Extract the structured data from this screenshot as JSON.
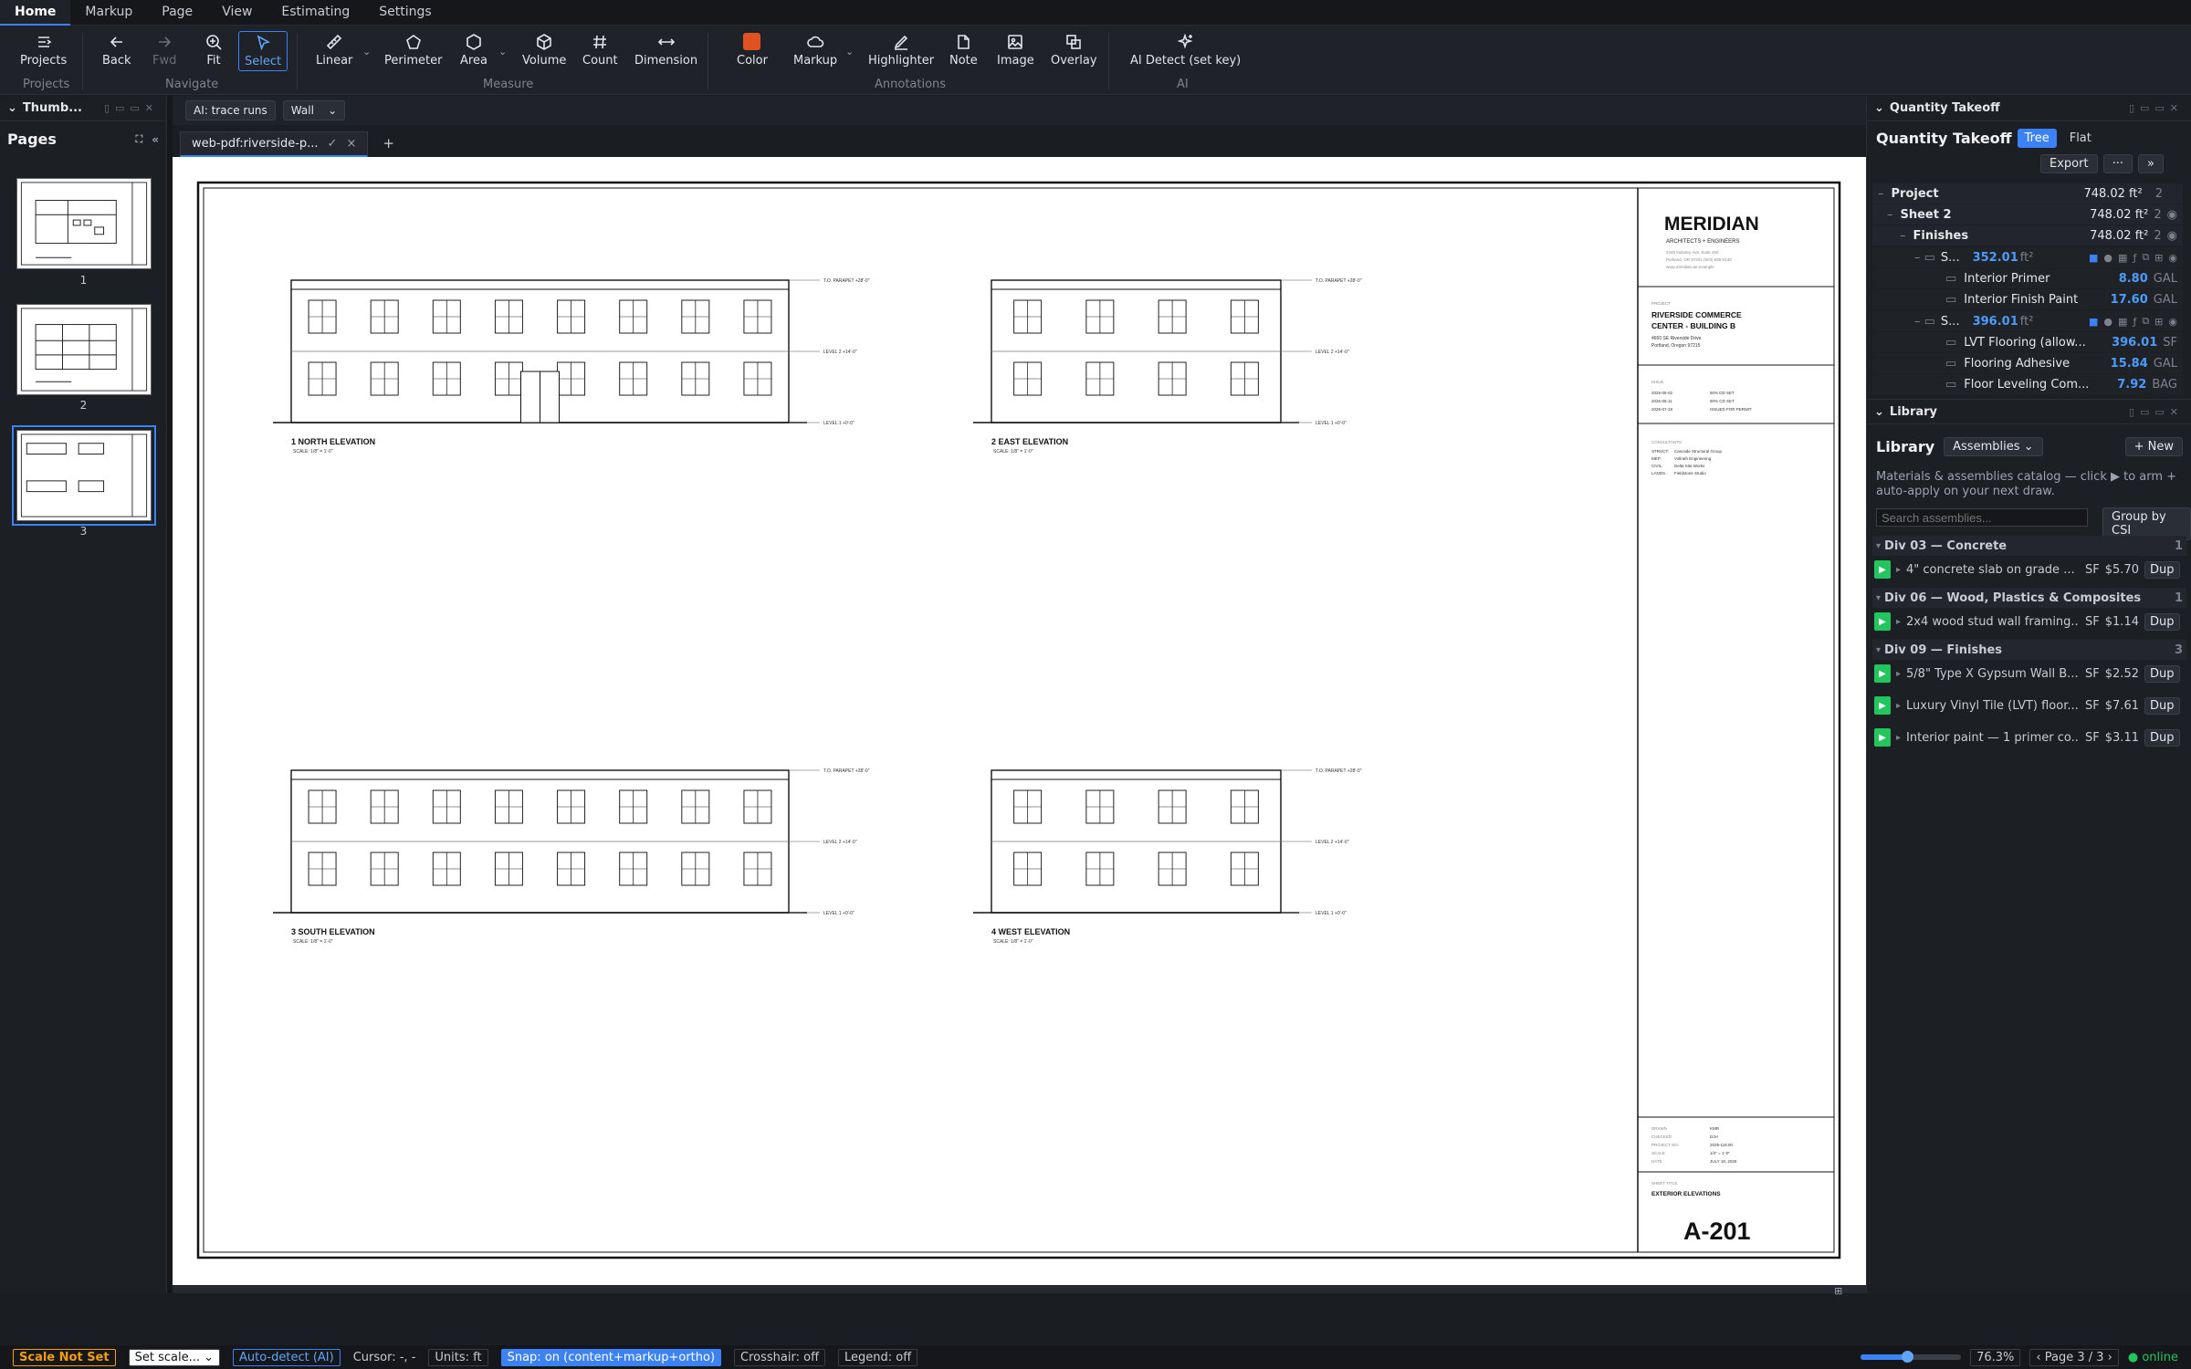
{
  "menu": {
    "tabs": [
      "Home",
      "Markup",
      "Page",
      "View",
      "Estimating",
      "Settings"
    ]
  },
  "ribbon": {
    "projects": "Projects",
    "back": "Back",
    "fwd": "Fwd",
    "fit": "Fit",
    "select": "Select",
    "linear": "Linear",
    "perimeter": "Perimeter",
    "area": "Area",
    "volume": "Volume",
    "count": "Count",
    "dimension": "Dimension",
    "color": "Color",
    "markup": "Markup",
    "highlighter": "Highlighter",
    "note": "Note",
    "image": "Image",
    "overlay": "Overlay",
    "ai_detect": "AI Detect (set key)",
    "groups": {
      "projects": "Projects",
      "navigate": "Navigate",
      "measure": "Measure",
      "annotations": "Annotations",
      "ai": "AI"
    },
    "color_value": "#e0521f"
  },
  "left": {
    "panel_title": "Thumb...",
    "pages_title": "Pages",
    "pages": [
      "1",
      "2",
      "3"
    ]
  },
  "toolrow": {
    "ai_trace": "AI: trace runs",
    "wall": "Wall"
  },
  "doc": {
    "tab": "web-pdf:riverside-p...",
    "tab_check": "✓",
    "tab_close": "×",
    "add": "+"
  },
  "sheet": {
    "firm": "MERIDIAN",
    "firm_sub": "ARCHITECTS + ENGINEERS",
    "firm_addr1": "2345 Industry Ave, Suite 450",
    "firm_addr2": "Portland, OR 97201 (503) 555-0140",
    "firm_addr3": "www.meridian-ae.example",
    "project_label": "PROJECT",
    "project1": "RIVERSIDE COMMERCE",
    "project2": "CENTER - BUILDING B",
    "addr1": "4650 SE Riverside Drive",
    "addr2": "Portland, Oregon 97215",
    "issue_label": "ISSUE",
    "issues": [
      [
        "2026-05-02",
        "90% DD SET"
      ],
      [
        "2026-06-11",
        "90% CD SET"
      ],
      [
        "2026-07-18",
        "ISSUED FOR PERMIT"
      ]
    ],
    "consult_label": "CONSULTANTS",
    "consultants": [
      [
        "STRUCT:",
        "Cascade Structural Group"
      ],
      [
        "MEP:",
        "Vollrath Engineering"
      ],
      [
        "CIVIL:",
        "Delta Site Works"
      ],
      [
        "LANDS.:",
        "Fieldstone Studio"
      ]
    ],
    "meta": [
      [
        "DRAWN",
        "KMR"
      ],
      [
        "CHECKED",
        "DJH"
      ],
      [
        "PROJECT NO.",
        "2025-118.00"
      ],
      [
        "SCALE",
        "1/4\" = 1'-0\""
      ],
      [
        "DATE",
        "JULY 18, 2026"
      ]
    ],
    "sheet_title_label": "SHEET TITLE",
    "sheet_title": "EXTERIOR ELEVATIONS",
    "sheet_no": "A-201",
    "elevations": [
      {
        "title": "1  NORTH ELEVATION",
        "scale": "SCALE: 1/8\" = 1'-0\""
      },
      {
        "title": "2  EAST ELEVATION",
        "scale": "SCALE: 1/8\" = 1'-0\""
      },
      {
        "title": "3  SOUTH ELEVATION",
        "scale": "SCALE: 1/8\" = 1'-0\""
      },
      {
        "title": "4  WEST ELEVATION",
        "scale": "SCALE: 1/8\" = 1'-0\""
      }
    ],
    "levels": {
      "parapet": "T.O. PARAPET  +28'-0\"",
      "l2": "LEVEL 2  +14'-0\"",
      "l1": "LEVEL 1  +0'-0\""
    }
  },
  "qt": {
    "panel_title": "Quantity Takeoff",
    "title": "Quantity Takeoff",
    "tree": "Tree",
    "flat": "Flat",
    "export": "Export",
    "more": "···",
    "expand": "»",
    "rows": [
      {
        "label": "Project",
        "value": "748.02 ft²",
        "count": "2"
      },
      {
        "label": "Sheet 2",
        "value": "748.02 ft²",
        "count": "2"
      },
      {
        "label": "Finishes",
        "value": "748.02 ft²",
        "count": "2"
      },
      {
        "label": "S...",
        "value": "352.01",
        "unit": "ft²"
      },
      {
        "label": "Interior Primer",
        "value": "8.80",
        "unit": "GAL"
      },
      {
        "label": "Interior Finish Paint",
        "value": "17.60",
        "unit": "GAL"
      },
      {
        "label": "S...",
        "value": "396.01",
        "unit": "ft²"
      },
      {
        "label": "LVT Flooring (allow...",
        "value": "396.01",
        "unit": "SF"
      },
      {
        "label": "Flooring Adhesive",
        "value": "15.84",
        "unit": "GAL"
      },
      {
        "label": "Floor Leveling Com...",
        "value": "7.92",
        "unit": "BAG"
      }
    ]
  },
  "lib": {
    "panel_title": "Library",
    "title": "Library",
    "select": "Assemblies",
    "new": "+ New",
    "desc": "Materials & assemblies catalog — click ▶ to arm + auto-apply on your next draw.",
    "search_placeholder": "Search assemblies...",
    "group": "Group by CSI",
    "divisions": [
      {
        "name": "Div 03 — Concrete",
        "count": "1",
        "items": [
          {
            "name": "4\" concrete slab on grade ...",
            "unit": "SF",
            "price": "$5.70"
          }
        ]
      },
      {
        "name": "Div 06 — Wood, Plastics & Composites",
        "count": "1",
        "items": [
          {
            "name": "2x4 wood stud wall framing...",
            "unit": "SF",
            "price": "$1.14"
          }
        ]
      },
      {
        "name": "Div 09 — Finishes",
        "count": "3",
        "items": [
          {
            "name": "5/8\" Type X Gypsum Wall B...",
            "unit": "SF",
            "price": "$2.52"
          },
          {
            "name": "Luxury Vinyl Tile (LVT) floor...",
            "unit": "SF",
            "price": "$7.61"
          },
          {
            "name": "Interior paint — 1 primer co...",
            "unit": "SF",
            "price": "$3.11"
          }
        ]
      }
    ],
    "dup": "Dup"
  },
  "status": {
    "scale": "Scale Not Set",
    "set_scale": "Set scale...",
    "auto": "Auto-detect (AI)",
    "cursor": "Cursor: -, -",
    "units": "Units: ft",
    "snap": "Snap: on (content+markup+ortho)",
    "crosshair": "Crosshair: off",
    "legend": "Legend: off",
    "zoom": "76.3%",
    "zoom_fraction": 0.46,
    "page": "Page 3 / 3",
    "online": "online",
    "prev": "‹",
    "next": "›"
  }
}
